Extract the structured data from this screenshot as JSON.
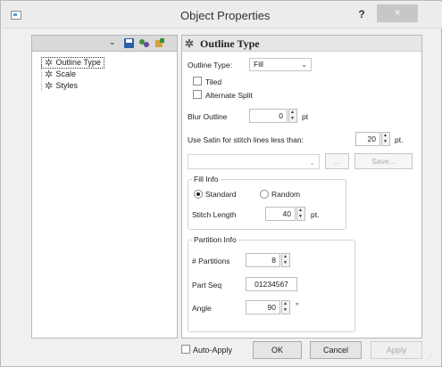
{
  "window": {
    "title": "Object Properties",
    "help": "?",
    "close": "×"
  },
  "tree": {
    "items": [
      {
        "label": "Outline Type",
        "selected": true
      },
      {
        "label": "Scale",
        "selected": false
      },
      {
        "label": "Styles",
        "selected": false
      }
    ],
    "toolbar_icons": [
      "chevron-down-icon",
      "save-icon",
      "wizard-icon",
      "tool-icon"
    ]
  },
  "panel": {
    "header": "Outline Type",
    "outline_type": {
      "label": "Outline Type:",
      "value": "Fill"
    },
    "tiled": {
      "label": "Tiled",
      "checked": false
    },
    "alternate_split": {
      "label": "Alternate Split",
      "checked": false
    },
    "blur_outline": {
      "label": "Blur Outline",
      "value": "0",
      "unit": "pt"
    },
    "satin": {
      "label": "Use Satin for stitch lines less than:",
      "value": "20",
      "unit": "pt."
    },
    "preset": {
      "value": "",
      "more": "...",
      "save": "Save..."
    },
    "fill_info": {
      "title": "Fill Info",
      "standard": "Standard",
      "random": "Random",
      "selected": "Standard",
      "stitch_length": {
        "label": "Stitch Length",
        "value": "40",
        "unit": "pt."
      }
    },
    "partition_info": {
      "title": "Partition Info",
      "partitions": {
        "label": "# Partitions",
        "value": "8"
      },
      "part_seq": {
        "label": "Part Seq",
        "value": "01234567"
      },
      "angle": {
        "label": "Angle",
        "value": "90",
        "unit": "°"
      }
    }
  },
  "footer": {
    "auto_apply": {
      "label": "Auto-Apply",
      "checked": false
    },
    "ok": "OK",
    "cancel": "Cancel",
    "apply": "Apply"
  }
}
